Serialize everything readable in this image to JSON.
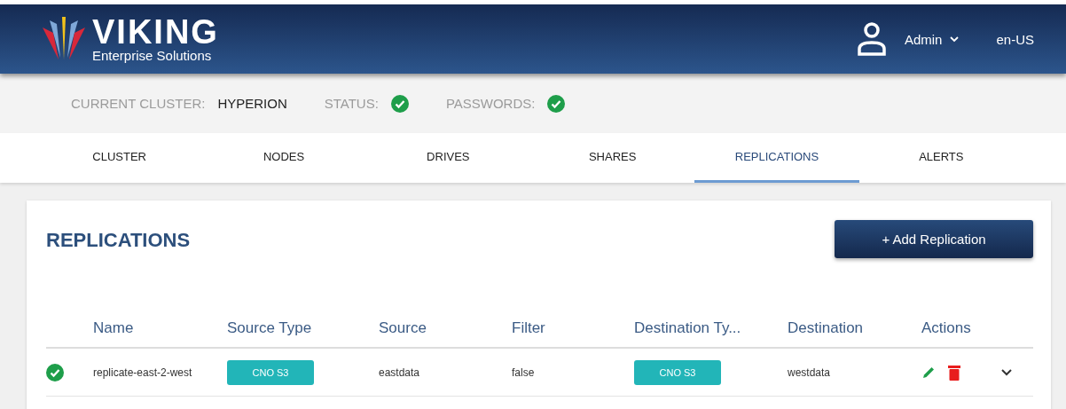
{
  "header": {
    "brand": "VIKING",
    "tagline": "Enterprise Solutions",
    "user": "Admin",
    "locale": "en-US"
  },
  "cluster_bar": [
    {
      "kind": "text",
      "label": "CURRENT CLUSTER:",
      "value": "HYPERION"
    },
    {
      "kind": "status",
      "label": "STATUS:",
      "ok": true
    },
    {
      "kind": "status",
      "label": "PASSWORDS:",
      "ok": true
    }
  ],
  "tabs": [
    {
      "label": "CLUSTER",
      "selected": false
    },
    {
      "label": "NODES",
      "selected": false
    },
    {
      "label": "DRIVES",
      "selected": false
    },
    {
      "label": "SHARES",
      "selected": false
    },
    {
      "label": "REPLICATIONS",
      "selected": true
    },
    {
      "label": "ALERTS",
      "selected": false
    }
  ],
  "panel": {
    "title": "REPLICATIONS",
    "add_button": "+ Add Replication"
  },
  "table": {
    "columns": [
      "Name",
      "Source Type",
      "Source",
      "Filter",
      "Destination Ty...",
      "Destination",
      "Actions"
    ],
    "rows": [
      {
        "ok": true,
        "name": "replicate-east-2-west",
        "source_type": "CNO S3",
        "source": "eastdata",
        "filter": "false",
        "destination_type": "CNO S3",
        "destination": "westdata",
        "expanded": false
      }
    ]
  }
}
